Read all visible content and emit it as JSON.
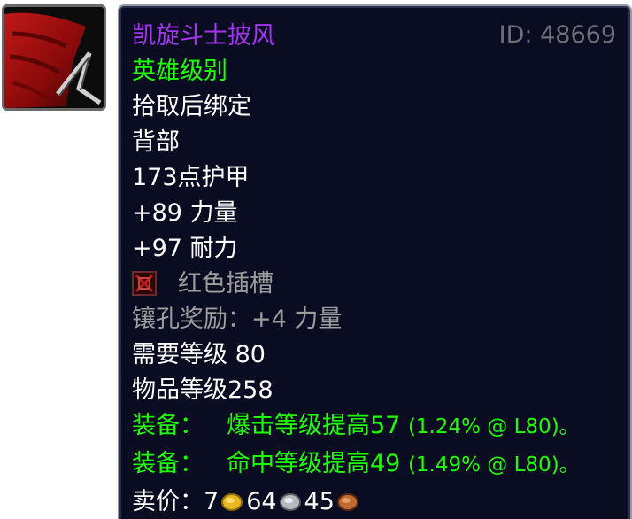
{
  "item": {
    "name": "凯旋斗士披风",
    "id_label": "ID: 48669",
    "quality": "英雄级别",
    "binding": "拾取后绑定",
    "slot": "背部",
    "armor": "173点护甲",
    "stat_strength": "+89 力量",
    "stat_stamina": "+97 耐力",
    "socket_label": "红色插槽",
    "socket_bonus": "镶孔奖励：+4 力量",
    "required_level": "需要等级 80",
    "item_level": "物品等级258",
    "equip_1_prefix": "装备：",
    "equip_1_text": "爆击等级提高57",
    "equip_1_detail": "(1.24% @ L80)。",
    "equip_2_prefix": "装备：",
    "equip_2_text": "命中等级提高49",
    "equip_2_detail": "(1.49% @ L80)。",
    "sell_label": "卖价：",
    "sell_gold": "7",
    "sell_silver": "64",
    "sell_copper": "45"
  },
  "icons": {
    "item": "red-cloak-icon",
    "socket": "red-socket-icon",
    "gold": "gold-coin-icon",
    "silver": "silver-coin-icon",
    "copper": "copper-coin-icon"
  },
  "colors": {
    "tooltip_bg": "#0a0c22",
    "epic": "#a335ee",
    "green": "#1eff00",
    "grey": "#9d9d9d",
    "white": "#ffffff",
    "id_grey": "#6f6f78"
  }
}
